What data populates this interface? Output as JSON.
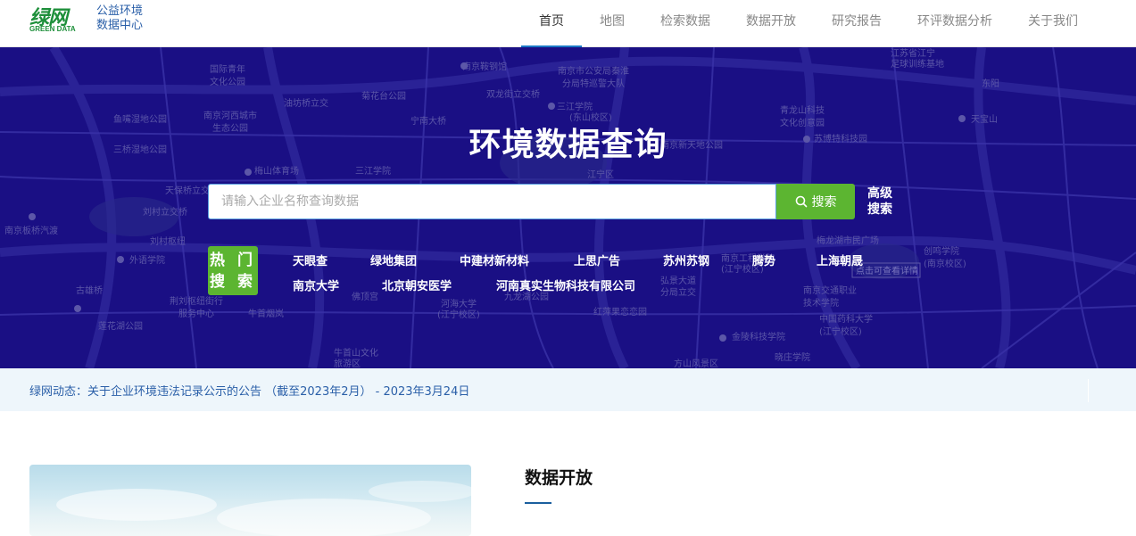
{
  "brand": {
    "logo_cn": "绿网",
    "logo_en": "GREEN DATA",
    "subtitle_line1": "公益环境",
    "subtitle_line2": "数据中心"
  },
  "nav": {
    "items": [
      {
        "label": "首页",
        "active": true
      },
      {
        "label": "地图"
      },
      {
        "label": "检索数据"
      },
      {
        "label": "数据开放"
      },
      {
        "label": "研究报告"
      },
      {
        "label": "环评数据分析"
      },
      {
        "label": "关于我们"
      }
    ]
  },
  "hero": {
    "title": "环境数据查询",
    "search_placeholder": "请输入企业名称查询数据",
    "search_value": "",
    "search_button": "搜索",
    "advanced_search_line1": "高级",
    "advanced_search_line2": "搜索",
    "hot_label_line1": "热 门",
    "hot_label_line2": "搜 索",
    "hot_row1": [
      "天眼查",
      "绿地集团",
      "中建材新材料",
      "上思广告",
      "苏州苏钢",
      "腾势",
      "上海朝晟"
    ],
    "hot_row2": [
      "南京大学",
      "北京朝安医学",
      "河南真实生物科技有限公司"
    ]
  },
  "news": {
    "text": "绿网动态：关于企业环境违法记录公示的公告 （截至2023年2月） - 2023年3月24日"
  },
  "section": {
    "title": "数据开放"
  },
  "map_labels": [
    "国际青年\n文化公园",
    "南京河西城市\n生态公园",
    "鱼嘴湿地公园",
    "三桥湿地公园",
    "天保桥立交",
    "刘村立交桥",
    "南京板桥汽渡",
    "刘村枢纽",
    "外语学院",
    "古雄桥",
    "荆刘枢纽街行\n服务中心",
    "莲花湖公园",
    "菊花台公园",
    "油坊桥立交",
    "宁南大桥",
    "梅山体育场",
    "三江学院",
    "南京鞍钢馆",
    "双龙街立交桥",
    "南京市公安局秦淮\n分局特巡警大队",
    "三江学院\n(东山校区)",
    "南京新天地公园",
    "江宁区",
    "青龙山科技\n文化创意园",
    "苏博特科技园",
    "江苏省江宁\n足球训练基地",
    "天宝山",
    "东阳",
    "梅龙湖市民广场",
    "南京工程学院\n(江宁校区)",
    "河海大学\n(江宁校区)",
    "九龙湖公园",
    "弘景大道\n分局立交",
    "红萍果恋恋园",
    "南京交通职业\n技术学院",
    "中国药科大学\n(江宁校区)",
    "金陵科技学院",
    "晓庄学院",
    "方山风景区",
    "牛首山文化\n旅游区",
    "牛首烟岚",
    "佛顶宫",
    "创鸣学院\n(南京校区)",
    "点击可查看详情"
  ]
}
